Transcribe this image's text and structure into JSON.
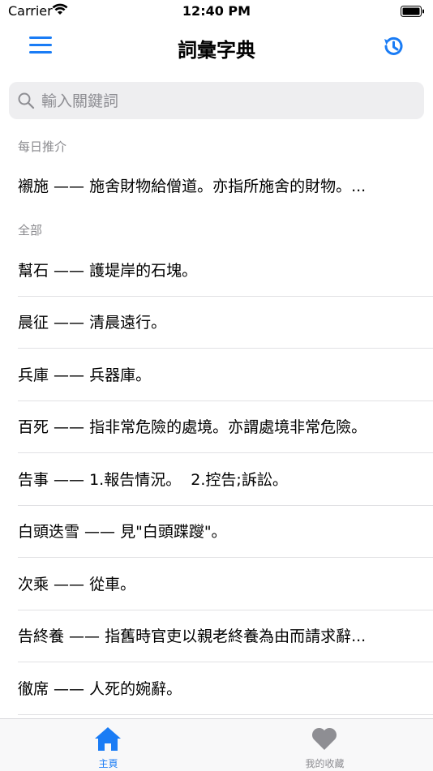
{
  "status_bar": {
    "carrier": "Carrier",
    "time": "12:40 PM"
  },
  "nav": {
    "title": "詞彙字典"
  },
  "search": {
    "placeholder": "輸入關鍵詞"
  },
  "daily": {
    "header": "每日推介",
    "item": "襯施 —— 施舍財物給僧道。亦指所施舍的財物。..."
  },
  "all": {
    "header": "全部",
    "items": [
      "幫石 —— 護堤岸的石塊。",
      "晨征 —— 清晨遠行。",
      "兵庫 —— 兵器庫。",
      "百死 —— 指非常危險的處境。亦謂處境非常危險。",
      "告事 —— 1.報告情況。  2.控告;訴訟。",
      "白頭迭雪 —— 見\"白頭蹀躞\"。",
      "次乘 —— 從車。",
      "告終養 —— 指舊時官吏以親老終養為由而請求辭...",
      "徹席 —— 人死的婉辭。"
    ]
  },
  "tabs": [
    {
      "label": "主頁",
      "active": true
    },
    {
      "label": "我的收藏",
      "active": false
    }
  ],
  "colors": {
    "accent": "#1a7cf5",
    "inactive": "#8e8e93"
  }
}
